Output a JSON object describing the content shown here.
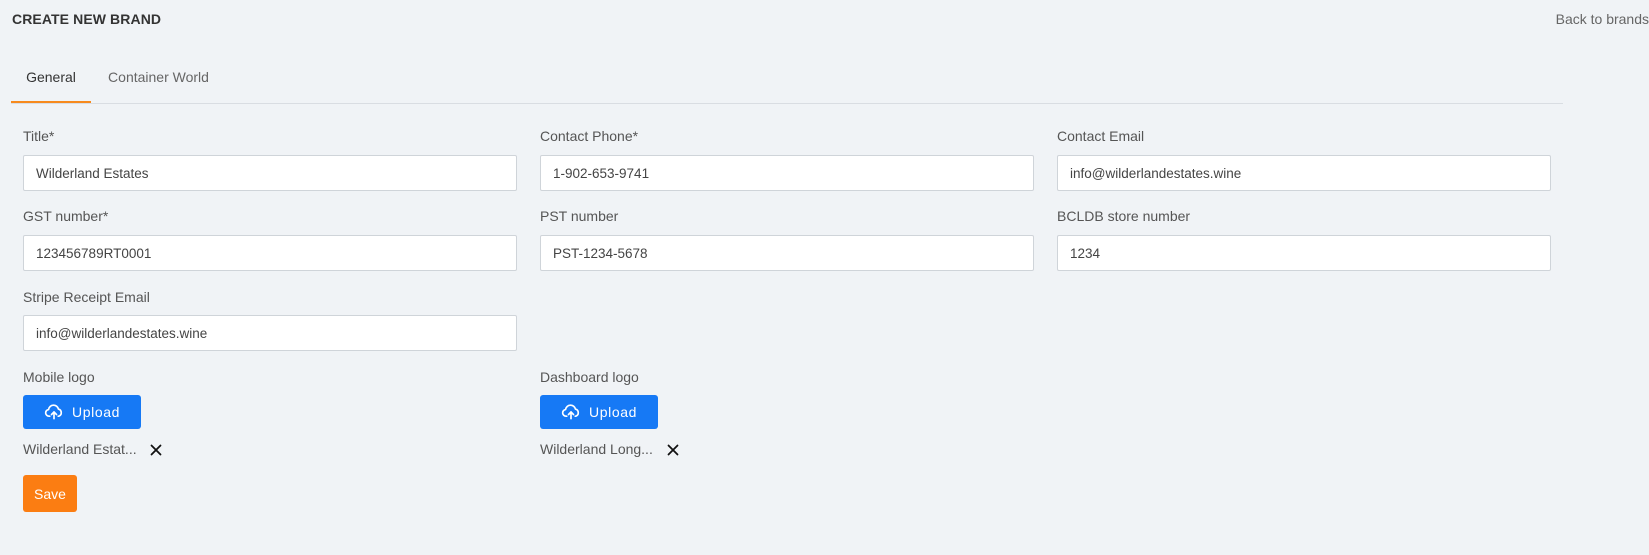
{
  "header": {
    "title": "CREATE NEW BRAND",
    "back_link": "Back to brands"
  },
  "tabs": [
    {
      "label": "General",
      "active": true
    },
    {
      "label": "Container World",
      "active": false
    }
  ],
  "form": {
    "title": {
      "label": "Title*",
      "value": "Wilderland Estates"
    },
    "contact_phone": {
      "label": "Contact Phone*",
      "value": "1-902-653-9741"
    },
    "contact_email": {
      "label": "Contact Email",
      "value": "info@wilderlandestates.wine"
    },
    "gst_number": {
      "label": "GST number*",
      "value": "123456789RT0001"
    },
    "pst_number": {
      "label": "PST number",
      "value": "PST-1234-5678"
    },
    "bcldb_store_number": {
      "label": "BCLDB store number",
      "value": "1234"
    },
    "stripe_receipt_email": {
      "label": "Stripe Receipt Email",
      "value": "info@wilderlandestates.wine"
    }
  },
  "mobile_logo": {
    "label": "Mobile logo",
    "upload_label": "Upload",
    "file_name": "Wilderland Estat..."
  },
  "dashboard_logo": {
    "label": "Dashboard logo",
    "upload_label": "Upload",
    "file_name": "Wilderland Long..."
  },
  "save_label": "Save",
  "colors": {
    "accent_orange": "#fb7d12",
    "tab_underline": "#f78a1d",
    "upload_blue": "#1679f5",
    "background": "#f0f3f6"
  },
  "icons": {
    "upload": "cloud-upload-icon",
    "remove": "close-icon"
  }
}
